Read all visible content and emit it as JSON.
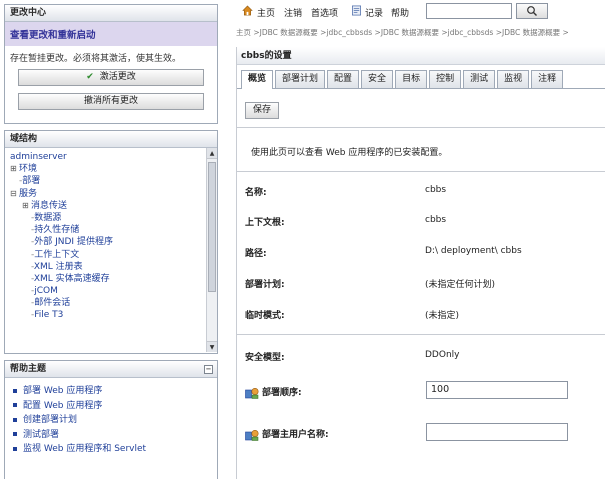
{
  "change_center": {
    "header": "更改中心",
    "title": "查看更改和重新启动",
    "message": "存在暂挂更改。必须将其激活，使其生效。",
    "activate_label": "激活更改",
    "undo_label": "撤消所有更改"
  },
  "domain_structure": {
    "header": "域结构",
    "root": "adminserver",
    "rows": [
      {
        "toggle": "⊞",
        "label": "环境",
        "indent": 0
      },
      {
        "toggle": "",
        "label": "部署",
        "indent": 0
      },
      {
        "toggle": "⊟",
        "label": "服务",
        "indent": 0
      },
      {
        "toggle": "⊞",
        "label": "消息传送",
        "indent": 1
      },
      {
        "toggle": "",
        "label": "数据源",
        "indent": 1
      },
      {
        "toggle": "",
        "label": "持久性存储",
        "indent": 1
      },
      {
        "toggle": "",
        "label": "外部 JNDI 提供程序",
        "indent": 1
      },
      {
        "toggle": "",
        "label": "工作上下文",
        "indent": 1
      },
      {
        "toggle": "",
        "label": "XML 注册表",
        "indent": 1
      },
      {
        "toggle": "",
        "label": "XML 实体高速缓存",
        "indent": 1
      },
      {
        "toggle": "",
        "label": "jCOM",
        "indent": 1
      },
      {
        "toggle": "",
        "label": "邮件会话",
        "indent": 1
      },
      {
        "toggle": "",
        "label": "File T3",
        "indent": 1
      }
    ]
  },
  "help_topics": {
    "header": "帮助主题",
    "items": [
      "部署 Web 应用程序",
      "配置 Web 应用程序",
      "创建部署计划",
      "测试部署",
      "监视 Web 应用程序和 Servlet"
    ]
  },
  "topnav": {
    "home": "主页",
    "logout": "注销",
    "preferences": "首选项",
    "record": "记录",
    "help": "帮助"
  },
  "breadcrumb": "主页 >JDBC 数据源概要 >jdbc_cbbsds >JDBC 数据源概要 >jdbc_cbbsds >JDBC 数据源概要 >",
  "main": {
    "title": "cbbs的设置",
    "tabs": [
      "概览",
      "部署计划",
      "配置",
      "安全",
      "目标",
      "控制",
      "测试",
      "监视",
      "注释"
    ],
    "save_label": "保存",
    "intro": "使用此页可以查看 Web 应用程序的已安装配置。",
    "fields": {
      "name_label": "名称:",
      "name_value": "cbbs",
      "context_label": "上下文根:",
      "context_value": "cbbs",
      "path_label": "路径:",
      "path_value": "D:\\ deployment\\ cbbs",
      "plan_label": "部署计划:",
      "plan_value": "(未指定任何计划)",
      "staging_label": "临时模式:",
      "staging_value": "(未指定)",
      "security_label": "安全模型:",
      "security_value": "DDOnly",
      "order_label": "部署顺序:",
      "order_value": "100",
      "principal_label": "部署主用户名称:",
      "principal_value": ""
    }
  },
  "colors": {
    "accent": "#1f3f99",
    "panel_highlight": "#dcd6ee",
    "border": "#9fa9b7"
  }
}
